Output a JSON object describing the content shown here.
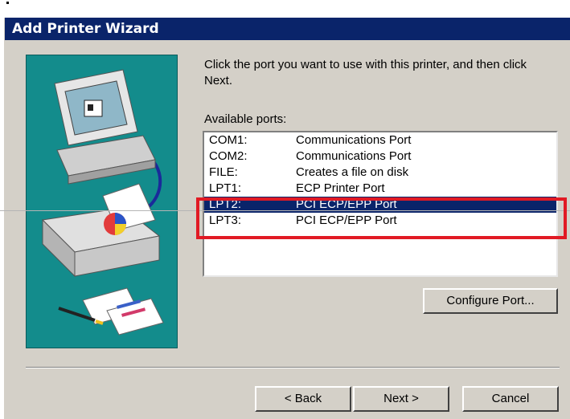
{
  "window": {
    "title": "Add Printer Wizard"
  },
  "main": {
    "instruction": "Click the port you want to use with this printer, and then click Next.",
    "ports_label": "Available ports:",
    "ports": [
      {
        "name": "COM1:",
        "description": "Communications Port",
        "selected": false
      },
      {
        "name": "COM2:",
        "description": "Communications Port",
        "selected": false
      },
      {
        "name": "FILE:",
        "description": "Creates a file on disk",
        "selected": false
      },
      {
        "name": "LPT1:",
        "description": "ECP Printer Port",
        "selected": false
      },
      {
        "name": "LPT2:",
        "description": "PCI ECP/EPP Port",
        "selected": true
      },
      {
        "name": "LPT3:",
        "description": "PCI ECP/EPP Port",
        "selected": false
      }
    ],
    "configure_button": "Configure Port..."
  },
  "footer": {
    "back_button": "< Back",
    "next_button": "Next >",
    "cancel_button": "Cancel"
  },
  "colors": {
    "title_bar": "#0a246a",
    "selection": "#0a246a",
    "annotation_box": "#e11a24",
    "art_background": "#138c8c"
  }
}
